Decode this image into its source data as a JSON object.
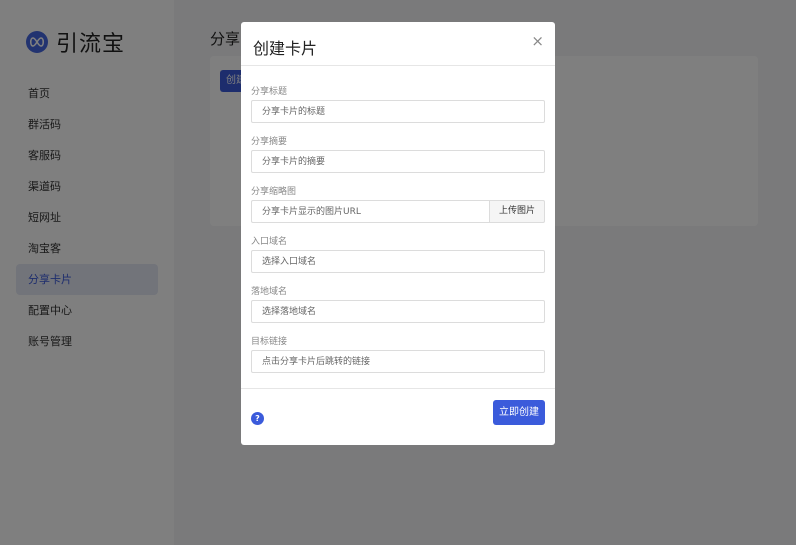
{
  "brand": {
    "name": "引流宝",
    "icon": "infinity-logo-icon",
    "accent": "#3b5bdb"
  },
  "sidebar": {
    "items": [
      {
        "label": "首页"
      },
      {
        "label": "群活码"
      },
      {
        "label": "客服码"
      },
      {
        "label": "渠道码"
      },
      {
        "label": "短网址"
      },
      {
        "label": "淘宝客"
      },
      {
        "label": "分享卡片",
        "active": true
      },
      {
        "label": "配置中心"
      },
      {
        "label": "账号管理"
      }
    ]
  },
  "main": {
    "title": "分享",
    "create_button": "创建"
  },
  "modal": {
    "title": "创建卡片",
    "close_icon": "×",
    "fields": {
      "title": {
        "label": "分享标题",
        "placeholder": "分享卡片的标题"
      },
      "summary": {
        "label": "分享摘要",
        "placeholder": "分享卡片的摘要"
      },
      "thumbnail": {
        "label": "分享缩略图",
        "placeholder": "分享卡片显示的图片URL",
        "button": "上传图片"
      },
      "entry_domain": {
        "label": "入口域名",
        "placeholder": "选择入口域名"
      },
      "landing_domain": {
        "label": "落地域名",
        "placeholder": "选择落地域名"
      },
      "target_link": {
        "label": "目标链接",
        "placeholder": "点击分享卡片后跳转的链接"
      }
    },
    "help_icon": "?",
    "submit": "立即创建"
  }
}
